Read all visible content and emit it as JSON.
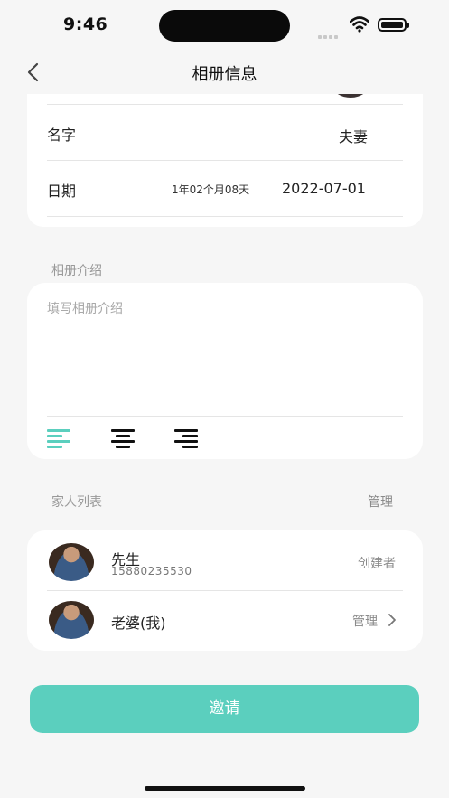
{
  "status_bar": {
    "time": "9:46"
  },
  "nav": {
    "title": "相册信息",
    "back_icon": "chevron-left-icon"
  },
  "info": {
    "name_label": "名字",
    "name_value": "夫妻",
    "date_label": "日期",
    "duration": "1年02个月08天",
    "date_value": "2022-07-01"
  },
  "intro": {
    "section_label": "相册介绍",
    "placeholder": "填写相册介绍",
    "value": "",
    "align_options": [
      "align-left",
      "align-center",
      "align-right"
    ],
    "selected_align": "align-left",
    "accent_color": "#5bcfbe"
  },
  "family": {
    "section_label": "家人列表",
    "manage_label": "管理",
    "members": [
      {
        "name": "先生",
        "phone": "15880235530",
        "role": "创建者"
      },
      {
        "name": "老婆(我)",
        "phone": "",
        "role": "管理"
      }
    ]
  },
  "invite_label": "邀请"
}
